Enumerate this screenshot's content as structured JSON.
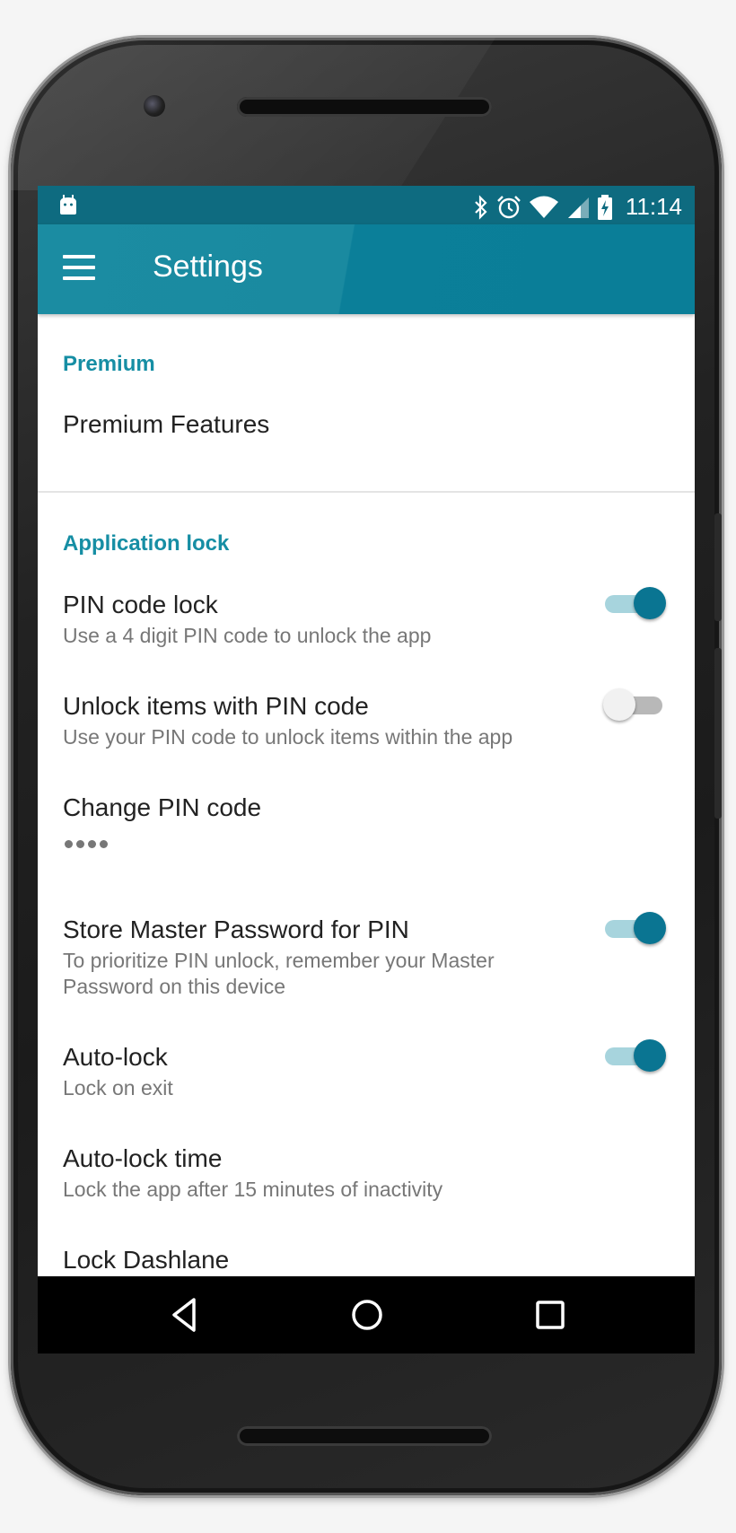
{
  "statusbar": {
    "time": "11:14",
    "icons": [
      "android-icon",
      "bluetooth-icon",
      "alarm-icon",
      "wifi-icon",
      "signal-icon",
      "battery-charging-icon"
    ]
  },
  "appbar": {
    "menu_icon": "hamburger-menu-icon",
    "title": "Settings"
  },
  "sections": {
    "premium": {
      "header": "Premium",
      "items": [
        {
          "title": "Premium Features"
        }
      ]
    },
    "app_lock": {
      "header": "Application lock",
      "items": [
        {
          "title": "PIN code lock",
          "subtitle": "Use a 4 digit PIN code to unlock the app",
          "toggle": true
        },
        {
          "title": "Unlock items with PIN code",
          "subtitle": "Use your PIN code to unlock items within the app",
          "toggle": false
        },
        {
          "title": "Change PIN code",
          "value": "••••"
        },
        {
          "title": "Store Master Password for PIN",
          "subtitle_line1": "To prioritize PIN unlock, remember your Master",
          "subtitle_line2": "Password on this device",
          "toggle": true
        },
        {
          "title": "Auto-lock",
          "subtitle": "Lock on exit",
          "toggle": true
        },
        {
          "title": "Auto-lock time",
          "subtitle": "Lock the app after 15 minutes of inactivity"
        },
        {
          "title": "Lock Dashlane"
        }
      ]
    }
  },
  "navbar": {
    "buttons": [
      "back-icon",
      "home-icon",
      "recents-icon"
    ]
  },
  "colors": {
    "accent": "#168ea4",
    "appbar": "#1b8ca2",
    "statusbar": "#0e6b80",
    "toggle_on": "#0a7592"
  }
}
